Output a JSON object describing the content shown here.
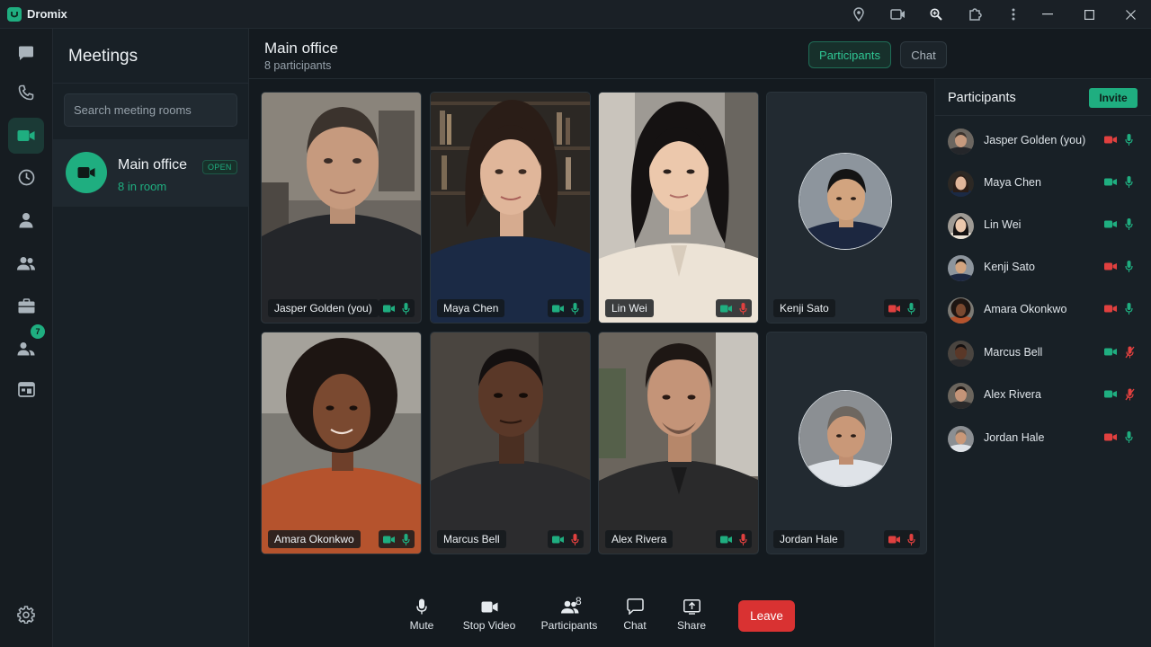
{
  "app": {
    "title": "Dromix"
  },
  "colors": {
    "accent": "#1fae80",
    "danger": "#e0403f",
    "background": "#141a1f"
  },
  "titlebar": {
    "icons": [
      "location-pin-icon",
      "video-icon",
      "zoom-icon",
      "extension-icon",
      "more-vertical-icon"
    ],
    "window_controls": [
      "minimize-icon",
      "maximize-icon",
      "close-icon"
    ]
  },
  "rail": {
    "items": [
      {
        "name": "chat",
        "icon": "message-icon",
        "active": false
      },
      {
        "name": "calls",
        "icon": "phone-icon",
        "active": false
      },
      {
        "name": "meetings",
        "icon": "video-icon",
        "active": true
      },
      {
        "name": "history",
        "icon": "clock-icon",
        "active": false
      },
      {
        "name": "contacts",
        "icon": "person-icon",
        "active": false
      },
      {
        "name": "groups",
        "icon": "people-icon",
        "active": false
      },
      {
        "name": "work",
        "icon": "briefcase-icon",
        "active": false
      },
      {
        "name": "requests",
        "icon": "people-badge-icon",
        "active": false,
        "badge": "7"
      },
      {
        "name": "calendar",
        "icon": "calendar-icon",
        "active": false
      }
    ],
    "settings_icon": "gear-icon"
  },
  "meetings_panel": {
    "title": "Meetings",
    "search_placeholder": "Search meeting rooms",
    "rooms": [
      {
        "name": "Main office",
        "status": "OPEN",
        "subtitle": "8 in room"
      }
    ]
  },
  "main": {
    "title": "Main office",
    "subtitle": "8 participants",
    "tabs": [
      {
        "label": "Participants",
        "active": true
      },
      {
        "label": "Chat",
        "active": false
      }
    ]
  },
  "tiles": [
    {
      "name": "Jasper Golden (you)",
      "camera": "on",
      "mic": "on",
      "video": true
    },
    {
      "name": "Maya Chen",
      "camera": "on",
      "mic": "on",
      "video": true
    },
    {
      "name": "Lin Wei",
      "camera": "on",
      "mic": "off",
      "video": true
    },
    {
      "name": "Kenji Sato",
      "camera": "off",
      "mic": "on",
      "video": false
    },
    {
      "name": "Amara Okonkwo",
      "camera": "on",
      "mic": "on",
      "video": true
    },
    {
      "name": "Marcus Bell",
      "camera": "on",
      "mic": "off",
      "video": true
    },
    {
      "name": "Alex Rivera",
      "camera": "on",
      "mic": "off",
      "video": true
    },
    {
      "name": "Jordan Hale",
      "camera": "off",
      "mic": "off",
      "video": false
    }
  ],
  "participants_panel": {
    "title": "Participants",
    "invite_label": "Invite",
    "list": [
      {
        "name": "Jasper Golden (you)",
        "camera": "off",
        "mic": "on"
      },
      {
        "name": "Maya Chen",
        "camera": "on",
        "mic": "on"
      },
      {
        "name": "Lin Wei",
        "camera": "on",
        "mic": "on"
      },
      {
        "name": "Kenji Sato",
        "camera": "off",
        "mic": "on"
      },
      {
        "name": "Amara Okonkwo",
        "camera": "off",
        "mic": "on"
      },
      {
        "name": "Marcus Bell",
        "camera": "on",
        "mic": "muted"
      },
      {
        "name": "Alex Rivera",
        "camera": "on",
        "mic": "muted"
      },
      {
        "name": "Jordan Hale",
        "camera": "off",
        "mic": "on"
      }
    ]
  },
  "controls": {
    "mute": "Mute",
    "stop_video": "Stop Video",
    "participants": "Participants",
    "participants_count": "8",
    "chat": "Chat",
    "share": "Share",
    "leave": "Leave"
  }
}
